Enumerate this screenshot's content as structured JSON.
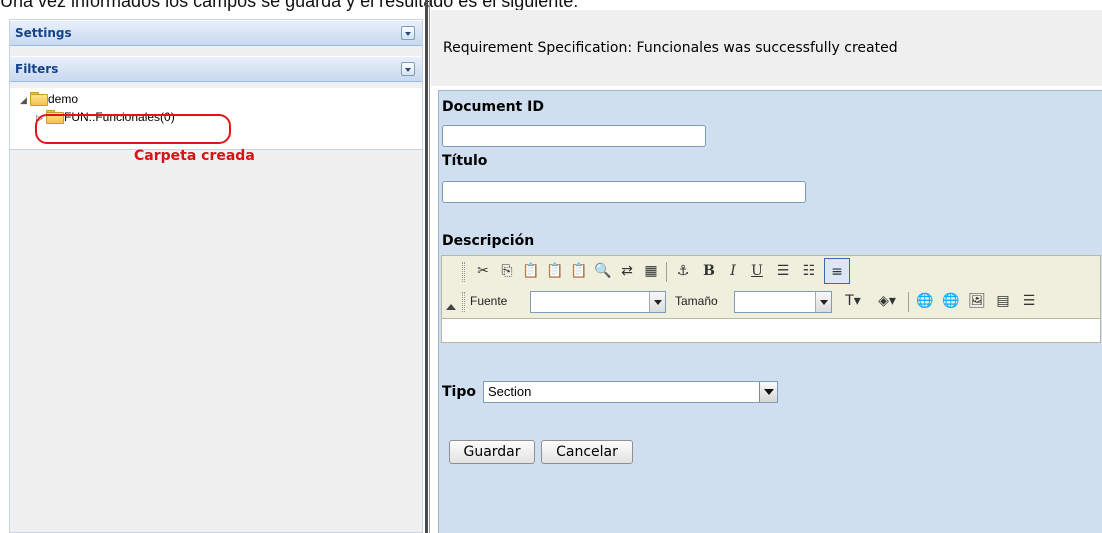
{
  "caption": "Una vez informados los campos se guarda y el resultado es el siguiente:",
  "left_panel": {
    "settings_title": "Settings",
    "filters_title": "Filters",
    "tree": [
      {
        "label": "demo",
        "expanded": true
      },
      {
        "label": "FUN::Funcionales(0)",
        "expanded": false
      }
    ],
    "annotation": "Carpeta creada",
    "annotation_color": "#d41414"
  },
  "success_message": "Requirement Specification: Funcionales was successfully created",
  "form": {
    "document_id_label": "Document ID",
    "document_id_value": "",
    "titulo_label": "Título",
    "titulo_value": "",
    "descripcion_label": "Descripción",
    "editor": {
      "row1_icons": [
        "cut-icon",
        "copy-icon",
        "paste-icon",
        "paste-text-icon",
        "paste-word-icon",
        "find-icon",
        "replace-icon",
        "select-all-icon",
        "anchor-icon",
        "bold-icon",
        "italic-icon",
        "underline-icon",
        "ordered-list-icon",
        "unordered-list-icon",
        "justify-left-icon"
      ],
      "font_label": "Fuente",
      "size_label": "Tamaño",
      "row2_icons": [
        "text-color-icon",
        "bg-color-icon",
        "link-icon",
        "unlink-icon",
        "image-icon",
        "table-icon",
        "horizontal-rule-icon"
      ]
    },
    "tipo_label": "Tipo",
    "tipo_selected": "Section",
    "save_label": "Guardar",
    "cancel_label": "Cancelar"
  },
  "colors": {
    "form_bg": "#cfdff0",
    "header_text": "#15428b"
  }
}
